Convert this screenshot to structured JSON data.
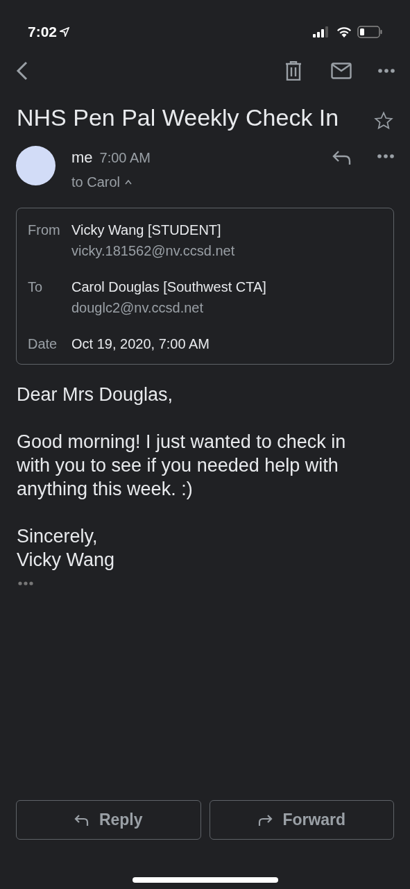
{
  "status_bar": {
    "time": "7:02"
  },
  "subject": "NHS Pen Pal Weekly Check In",
  "starred": false,
  "message": {
    "sender": "me",
    "time": "7:00 AM",
    "recipients": "to Carol",
    "details_expanded": true
  },
  "details": [
    {
      "label": "From",
      "name": "Vicky Wang [STUDENT]",
      "address": "vicky.181562@nv.ccsd.net"
    },
    {
      "label": "To",
      "name": "Carol Douglas [Southwest CTA]",
      "address": "douglc2@nv.ccsd.net"
    },
    {
      "label": "Date",
      "name": "Oct 19, 2020, 7:00 AM"
    }
  ],
  "body": [
    "Dear Mrs Douglas,",
    "Good morning! I just wanted to check in with you to see if you needed help with anything this week. :)"
  ],
  "signature": [
    "Sincerely,",
    "Vicky Wang"
  ],
  "actions": [
    {
      "kind": "reply",
      "label": "Reply"
    },
    {
      "kind": "forward",
      "label": "Forward"
    }
  ]
}
